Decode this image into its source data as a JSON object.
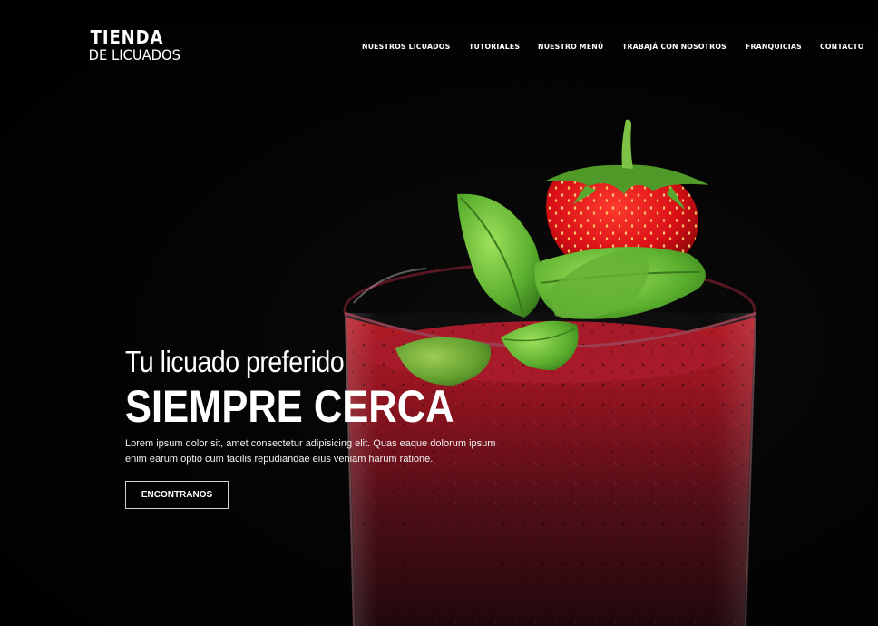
{
  "logo": {
    "line1": "TIENDA",
    "line2": "DE LICUADOS"
  },
  "nav": {
    "items": [
      {
        "label": "NUESTROS LICUADOS"
      },
      {
        "label": "TUTORIALES"
      },
      {
        "label": "NUESTRO MENÚ"
      },
      {
        "label": "TRABAJÁ CON NOSOTROS"
      },
      {
        "label": "FRANQUICIAS"
      },
      {
        "label": "CONTACTO"
      }
    ]
  },
  "hero": {
    "subtitle": "Tu licuado preferido",
    "title": "SIEMPRE CERCA",
    "description": "Lorem ipsum dolor sit, amet consectetur adipisicing elit. Quas eaque dolorum ipsum enim earum optio cum facilis repudiandae eius veniam harum ratione.",
    "cta_label": "ENCONTRANOS"
  },
  "colors": {
    "background": "#000000",
    "text": "#ffffff",
    "smoothie_red": "#8a0d1a",
    "strawberry": "#d8131b",
    "mint": "#5cb030"
  }
}
